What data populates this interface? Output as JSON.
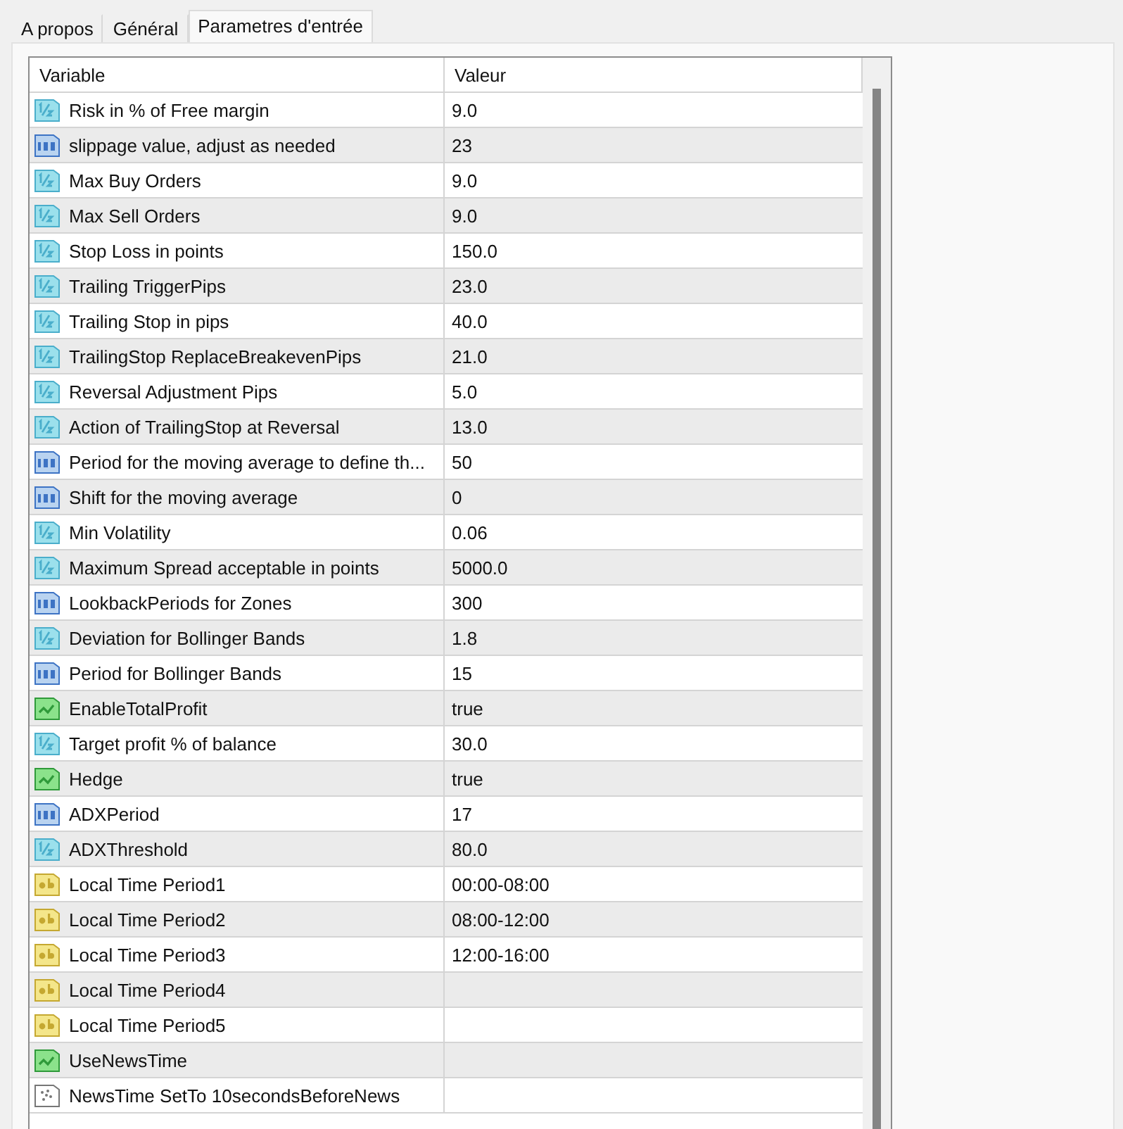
{
  "tabs": [
    {
      "label": "A propos",
      "selected": false
    },
    {
      "label": "Général",
      "selected": false
    },
    {
      "label": "Parametres d'entrée",
      "selected": true
    }
  ],
  "table": {
    "columns": [
      "Variable",
      "Valeur"
    ],
    "rows": [
      {
        "kind": "double",
        "variable": "Risk in % of Free margin",
        "value": "9.0"
      },
      {
        "kind": "int",
        "variable": "slippage value, adjust as needed",
        "value": "23"
      },
      {
        "kind": "double",
        "variable": "Max Buy Orders",
        "value": "9.0"
      },
      {
        "kind": "double",
        "variable": "Max Sell Orders",
        "value": "9.0"
      },
      {
        "kind": "double",
        "variable": "Stop Loss in points",
        "value": "150.0"
      },
      {
        "kind": "double",
        "variable": "Trailing TriggerPips",
        "value": "23.0"
      },
      {
        "kind": "double",
        "variable": "Trailing Stop in pips",
        "value": "40.0"
      },
      {
        "kind": "double",
        "variable": "TrailingStop ReplaceBreakevenPips",
        "value": "21.0"
      },
      {
        "kind": "double",
        "variable": "Reversal Adjustment Pips",
        "value": "5.0"
      },
      {
        "kind": "double",
        "variable": "Action of TrailingStop at Reversal",
        "value": "13.0"
      },
      {
        "kind": "int",
        "variable": "Period for the moving average to define th...",
        "value": "50"
      },
      {
        "kind": "int",
        "variable": "Shift for the moving average",
        "value": "0"
      },
      {
        "kind": "double",
        "variable": "Min Volatility",
        "value": "0.06"
      },
      {
        "kind": "double",
        "variable": "Maximum Spread acceptable in points",
        "value": "5000.0"
      },
      {
        "kind": "int",
        "variable": "LookbackPeriods for Zones",
        "value": "300"
      },
      {
        "kind": "double",
        "variable": "Deviation for Bollinger Bands",
        "value": "1.8"
      },
      {
        "kind": "int",
        "variable": "Period for Bollinger Bands",
        "value": "15"
      },
      {
        "kind": "bool",
        "variable": "EnableTotalProfit",
        "value": "true"
      },
      {
        "kind": "double",
        "variable": "Target profit % of balance",
        "value": "30.0"
      },
      {
        "kind": "bool",
        "variable": "Hedge",
        "value": "true"
      },
      {
        "kind": "int",
        "variable": "ADXPeriod",
        "value": "17"
      },
      {
        "kind": "double",
        "variable": "ADXThreshold",
        "value": "80.0"
      },
      {
        "kind": "string",
        "variable": "Local Time Period1",
        "value": "00:00-08:00"
      },
      {
        "kind": "string",
        "variable": "Local Time Period2",
        "value": "08:00-12:00"
      },
      {
        "kind": "string",
        "variable": "Local Time Period3",
        "value": "12:00-16:00"
      },
      {
        "kind": "string",
        "variable": "Local Time Period4"
      },
      {
        "kind": "string",
        "variable": "Local Time Period5"
      },
      {
        "kind": "bool",
        "variable": "UseNewsTime"
      },
      {
        "kind": "datetime",
        "variable": "NewsTime SetTo 10secondsBeforeNews"
      }
    ]
  }
}
